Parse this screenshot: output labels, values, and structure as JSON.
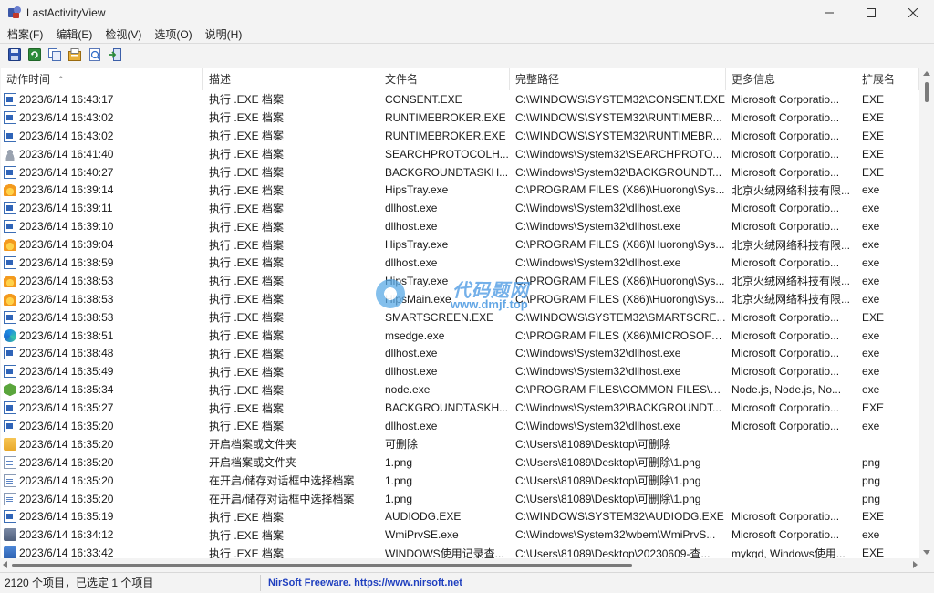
{
  "window": {
    "title": "LastActivityView"
  },
  "menu": [
    "档案(F)",
    "编辑(E)",
    "检视(V)",
    "选项(O)",
    "说明(H)"
  ],
  "toolbar_icons": [
    "save-icon",
    "refresh-icon",
    "copy-icon",
    "properties-icon",
    "html-report-icon",
    "exit-icon"
  ],
  "columns": [
    "动作时间",
    "描述",
    "文件名",
    "完整路径",
    "更多信息",
    "扩展名"
  ],
  "rows": [
    {
      "icon": "exe",
      "time": "2023/6/14 16:43:17",
      "desc": "执行 .EXE 档案",
      "file": "CONSENT.EXE",
      "path": "C:\\WINDOWS\\SYSTEM32\\CONSENT.EXE",
      "info": "Microsoft Corporatio...",
      "ext": "EXE"
    },
    {
      "icon": "exe",
      "time": "2023/6/14 16:43:02",
      "desc": "执行 .EXE 档案",
      "file": "RUNTIMEBROKER.EXE",
      "path": "C:\\WINDOWS\\SYSTEM32\\RUNTIMEBR...",
      "info": "Microsoft Corporatio...",
      "ext": "EXE"
    },
    {
      "icon": "exe",
      "time": "2023/6/14 16:43:02",
      "desc": "执行 .EXE 档案",
      "file": "RUNTIMEBROKER.EXE",
      "path": "C:\\WINDOWS\\SYSTEM32\\RUNTIMEBR...",
      "info": "Microsoft Corporatio...",
      "ext": "EXE"
    },
    {
      "icon": "user",
      "time": "2023/6/14 16:41:40",
      "desc": "执行 .EXE 档案",
      "file": "SEARCHPROTOCOLH...",
      "path": "C:\\Windows\\System32\\SEARCHPROTO...",
      "info": "Microsoft Corporatio...",
      "ext": "EXE"
    },
    {
      "icon": "exe",
      "time": "2023/6/14 16:40:27",
      "desc": "执行 .EXE 档案",
      "file": "BACKGROUNDTASKH...",
      "path": "C:\\Windows\\System32\\BACKGROUNDT...",
      "info": "Microsoft Corporatio...",
      "ext": "EXE"
    },
    {
      "icon": "fire",
      "time": "2023/6/14 16:39:14",
      "desc": "执行 .EXE 档案",
      "file": "HipsTray.exe",
      "path": "C:\\PROGRAM FILES (X86)\\Huorong\\Sys...",
      "info": "北京火绒网络科技有限...",
      "ext": "exe"
    },
    {
      "icon": "exe",
      "time": "2023/6/14 16:39:11",
      "desc": "执行 .EXE 档案",
      "file": "dllhost.exe",
      "path": "C:\\Windows\\System32\\dllhost.exe",
      "info": "Microsoft Corporatio...",
      "ext": "exe"
    },
    {
      "icon": "exe",
      "time": "2023/6/14 16:39:10",
      "desc": "执行 .EXE 档案",
      "file": "dllhost.exe",
      "path": "C:\\Windows\\System32\\dllhost.exe",
      "info": "Microsoft Corporatio...",
      "ext": "exe"
    },
    {
      "icon": "fire",
      "time": "2023/6/14 16:39:04",
      "desc": "执行 .EXE 档案",
      "file": "HipsTray.exe",
      "path": "C:\\PROGRAM FILES (X86)\\Huorong\\Sys...",
      "info": "北京火绒网络科技有限...",
      "ext": "exe"
    },
    {
      "icon": "exe",
      "time": "2023/6/14 16:38:59",
      "desc": "执行 .EXE 档案",
      "file": "dllhost.exe",
      "path": "C:\\Windows\\System32\\dllhost.exe",
      "info": "Microsoft Corporatio...",
      "ext": "exe"
    },
    {
      "icon": "fire",
      "time": "2023/6/14 16:38:53",
      "desc": "执行 .EXE 档案",
      "file": "HipsTray.exe",
      "path": "C:\\PROGRAM FILES (X86)\\Huorong\\Sys...",
      "info": "北京火绒网络科技有限...",
      "ext": "exe"
    },
    {
      "icon": "fire",
      "time": "2023/6/14 16:38:53",
      "desc": "执行 .EXE 档案",
      "file": "HipsMain.exe",
      "path": "C:\\PROGRAM FILES (X86)\\Huorong\\Sys...",
      "info": "北京火绒网络科技有限...",
      "ext": "exe"
    },
    {
      "icon": "exe",
      "time": "2023/6/14 16:38:53",
      "desc": "执行 .EXE 档案",
      "file": "SMARTSCREEN.EXE",
      "path": "C:\\WINDOWS\\SYSTEM32\\SMARTSCRE...",
      "info": "Microsoft Corporatio...",
      "ext": "EXE"
    },
    {
      "icon": "edge",
      "time": "2023/6/14 16:38:51",
      "desc": "执行 .EXE 档案",
      "file": "msedge.exe",
      "path": "C:\\PROGRAM FILES (X86)\\MICROSOFT\\...",
      "info": "Microsoft Corporatio...",
      "ext": "exe"
    },
    {
      "icon": "exe",
      "time": "2023/6/14 16:38:48",
      "desc": "执行 .EXE 档案",
      "file": "dllhost.exe",
      "path": "C:\\Windows\\System32\\dllhost.exe",
      "info": "Microsoft Corporatio...",
      "ext": "exe"
    },
    {
      "icon": "exe",
      "time": "2023/6/14 16:35:49",
      "desc": "执行 .EXE 档案",
      "file": "dllhost.exe",
      "path": "C:\\Windows\\System32\\dllhost.exe",
      "info": "Microsoft Corporatio...",
      "ext": "exe"
    },
    {
      "icon": "node",
      "time": "2023/6/14 16:35:34",
      "desc": "执行 .EXE 档案",
      "file": "node.exe",
      "path": "C:\\PROGRAM FILES\\COMMON FILES\\A...",
      "info": "Node.js, Node.js, No...",
      "ext": "exe"
    },
    {
      "icon": "exe",
      "time": "2023/6/14 16:35:27",
      "desc": "执行 .EXE 档案",
      "file": "BACKGROUNDTASKH...",
      "path": "C:\\Windows\\System32\\BACKGROUNDT...",
      "info": "Microsoft Corporatio...",
      "ext": "EXE"
    },
    {
      "icon": "exe",
      "time": "2023/6/14 16:35:20",
      "desc": "执行 .EXE 档案",
      "file": "dllhost.exe",
      "path": "C:\\Windows\\System32\\dllhost.exe",
      "info": "Microsoft Corporatio...",
      "ext": "exe"
    },
    {
      "icon": "folder",
      "time": "2023/6/14 16:35:20",
      "desc": "开启档案或文件夹",
      "file": "可删除",
      "path": "C:\\Users\\81089\\Desktop\\可删除",
      "info": "",
      "ext": ""
    },
    {
      "icon": "file",
      "time": "2023/6/14 16:35:20",
      "desc": "开启档案或文件夹",
      "file": "1.png",
      "path": "C:\\Users\\81089\\Desktop\\可删除\\1.png",
      "info": "",
      "ext": "png"
    },
    {
      "icon": "file",
      "time": "2023/6/14 16:35:20",
      "desc": "在开启/储存对话框中选择档案",
      "file": "1.png",
      "path": "C:\\Users\\81089\\Desktop\\可删除\\1.png",
      "info": "",
      "ext": "png"
    },
    {
      "icon": "file",
      "time": "2023/6/14 16:35:20",
      "desc": "在开启/储存对话框中选择档案",
      "file": "1.png",
      "path": "C:\\Users\\81089\\Desktop\\可删除\\1.png",
      "info": "",
      "ext": "png"
    },
    {
      "icon": "exe",
      "time": "2023/6/14 16:35:19",
      "desc": "执行 .EXE 档案",
      "file": "AUDIODG.EXE",
      "path": "C:\\WINDOWS\\SYSTEM32\\AUDIODG.EXE",
      "info": "Microsoft Corporatio...",
      "ext": "EXE"
    },
    {
      "icon": "wmi",
      "time": "2023/6/14 16:34:12",
      "desc": "执行 .EXE 档案",
      "file": "WmiPrvSE.exe",
      "path": "C:\\Windows\\System32\\wbem\\WmiPrvS...",
      "info": "Microsoft Corporatio...",
      "ext": "exe"
    },
    {
      "icon": "doc",
      "time": "2023/6/14 16:33:42",
      "desc": "执行 .EXE 档案",
      "file": "WINDOWS使用记录查...",
      "path": "C:\\Users\\81089\\Desktop\\20230609-查...",
      "info": "mykgd, Windows使用...",
      "ext": "EXE"
    }
  ],
  "status": {
    "count_text": "2120 个项目，已选定 1 个项目",
    "link_text": "NirSoft Freeware. https://www.nirsoft.net"
  },
  "watermark": {
    "text": "代码题网",
    "url": "www.dmjf.top"
  },
  "colors": {
    "link": "#1f3fbf",
    "background": "#f3f3f3",
    "list_bg": "#ffffff"
  }
}
